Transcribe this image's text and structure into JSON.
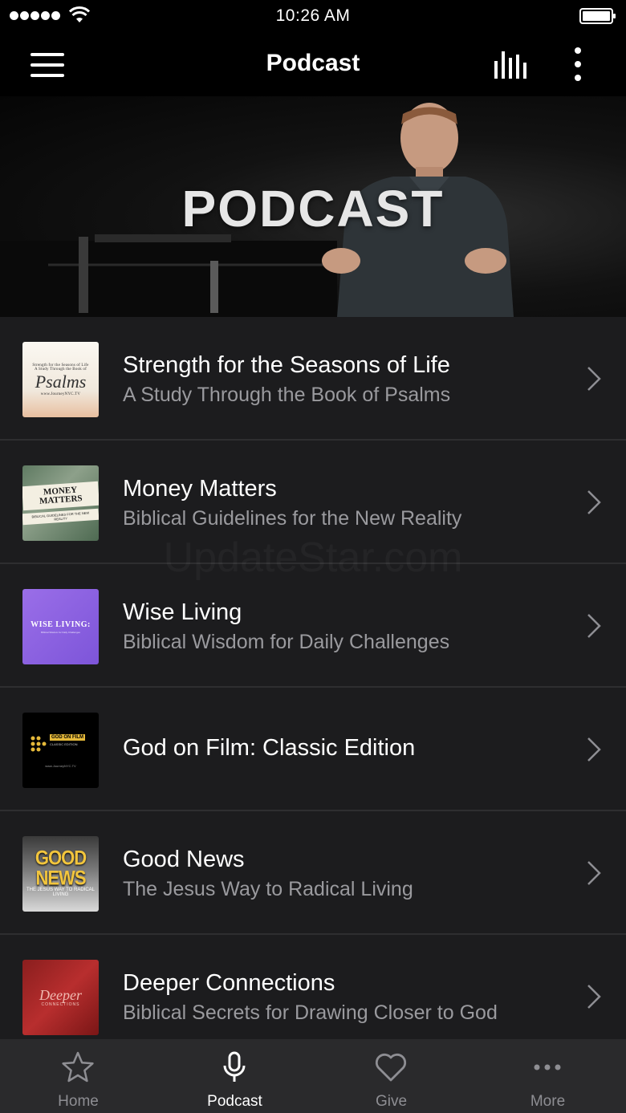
{
  "status_bar": {
    "time": "10:26 AM"
  },
  "nav": {
    "title": "Podcast"
  },
  "banner": {
    "title": "PODCAST"
  },
  "podcasts": [
    {
      "title": "Strength for the Seasons of Life",
      "subtitle": "A Study Through the Book of Psalms",
      "thumb_text": "Psalms",
      "thumb_small": "Strength for the Seasons of Life",
      "thumb_small_2": "A Study Through the Book of",
      "thumb_url": "www.JourneyNYC.TV"
    },
    {
      "title": "Money Matters",
      "subtitle": "Biblical Guidelines for the New Reality",
      "thumb_text": "MONEY MATTERS",
      "thumb_small": "BIBLICAL GUIDELINES FOR THE NEW REALITY"
    },
    {
      "title": "Wise Living",
      "subtitle": "Biblical Wisdom for Daily Challenges",
      "thumb_text": "WISE LIVING:",
      "thumb_small": "Biblical Wisdom for Daily Challenges"
    },
    {
      "title": "God on Film: Classic Edition",
      "subtitle": "",
      "thumb_text": "GOD ON FILM",
      "thumb_small": "CLASSIC EDITION",
      "thumb_url": "www.JourneyNYC.TV"
    },
    {
      "title": "Good News",
      "subtitle": "The Jesus Way to Radical Living",
      "thumb_text": "GOOD NEWS",
      "thumb_small": "THE JESUS WAY TO RADICAL LIVING"
    },
    {
      "title": "Deeper Connections",
      "subtitle": "Biblical Secrets for Drawing Closer to God",
      "thumb_text": "Deeper",
      "thumb_small": "CONNECTIONS"
    }
  ],
  "watermark": "UpdateStar.com",
  "tabs": [
    {
      "label": "Home",
      "icon": "star-icon",
      "active": false
    },
    {
      "label": "Podcast",
      "icon": "microphone-icon",
      "active": true
    },
    {
      "label": "Give",
      "icon": "heart-icon",
      "active": false
    },
    {
      "label": "More",
      "icon": "ellipsis-icon",
      "active": false
    }
  ],
  "colors": {
    "background": "#1c1c1e",
    "bar": "#000000",
    "tab_bar": "#2a2a2c",
    "subtitle": "#9a9a9e",
    "tab_inactive": "#8e8e93"
  }
}
